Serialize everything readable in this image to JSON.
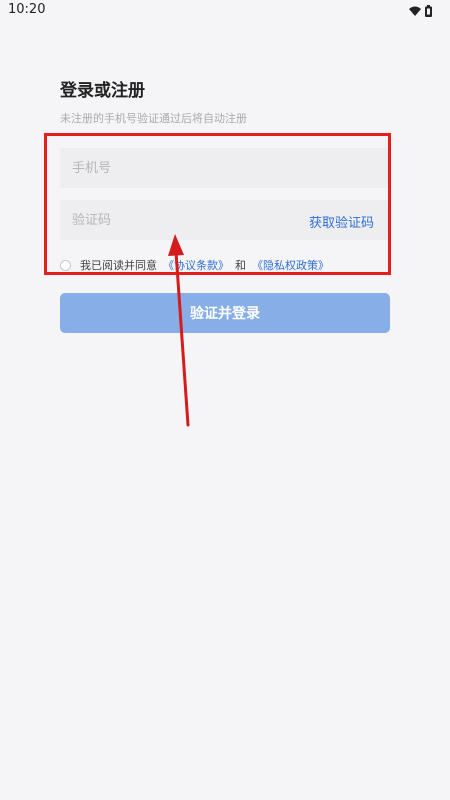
{
  "status_bar": {
    "time": "10:20",
    "icons": [
      "wifi-icon",
      "battery-icon"
    ]
  },
  "form": {
    "title": "登录或注册",
    "subtitle": "未注册的手机号验证通过后将自动注册",
    "phone_placeholder": "手机号",
    "code_placeholder": "验证码",
    "get_code_label": "获取验证码",
    "agreement": {
      "prefix": "我已阅读并同意",
      "terms_link": "《协议条款》",
      "conjunction": "和",
      "privacy_link": "《隐私权政策》"
    },
    "submit_label": "验证并登录"
  },
  "annotation": {
    "highlight_color": "#e51f1f"
  },
  "colors": {
    "accent": "#2f6fd6",
    "button": "#87aee6",
    "background": "#f5f5f7",
    "input_bg": "#eeeef0"
  }
}
